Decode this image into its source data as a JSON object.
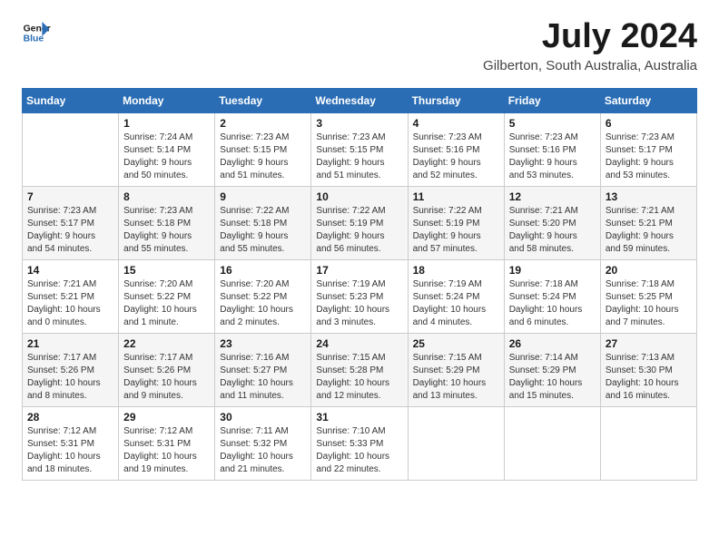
{
  "header": {
    "logo_line1": "General",
    "logo_line2": "Blue",
    "month": "July 2024",
    "location": "Gilberton, South Australia, Australia"
  },
  "weekdays": [
    "Sunday",
    "Monday",
    "Tuesday",
    "Wednesday",
    "Thursday",
    "Friday",
    "Saturday"
  ],
  "weeks": [
    [
      {
        "day": "",
        "info": ""
      },
      {
        "day": "1",
        "info": "Sunrise: 7:24 AM\nSunset: 5:14 PM\nDaylight: 9 hours\nand 50 minutes."
      },
      {
        "day": "2",
        "info": "Sunrise: 7:23 AM\nSunset: 5:15 PM\nDaylight: 9 hours\nand 51 minutes."
      },
      {
        "day": "3",
        "info": "Sunrise: 7:23 AM\nSunset: 5:15 PM\nDaylight: 9 hours\nand 51 minutes."
      },
      {
        "day": "4",
        "info": "Sunrise: 7:23 AM\nSunset: 5:16 PM\nDaylight: 9 hours\nand 52 minutes."
      },
      {
        "day": "5",
        "info": "Sunrise: 7:23 AM\nSunset: 5:16 PM\nDaylight: 9 hours\nand 53 minutes."
      },
      {
        "day": "6",
        "info": "Sunrise: 7:23 AM\nSunset: 5:17 PM\nDaylight: 9 hours\nand 53 minutes."
      }
    ],
    [
      {
        "day": "7",
        "info": "Sunrise: 7:23 AM\nSunset: 5:17 PM\nDaylight: 9 hours\nand 54 minutes."
      },
      {
        "day": "8",
        "info": "Sunrise: 7:23 AM\nSunset: 5:18 PM\nDaylight: 9 hours\nand 55 minutes."
      },
      {
        "day": "9",
        "info": "Sunrise: 7:22 AM\nSunset: 5:18 PM\nDaylight: 9 hours\nand 55 minutes."
      },
      {
        "day": "10",
        "info": "Sunrise: 7:22 AM\nSunset: 5:19 PM\nDaylight: 9 hours\nand 56 minutes."
      },
      {
        "day": "11",
        "info": "Sunrise: 7:22 AM\nSunset: 5:19 PM\nDaylight: 9 hours\nand 57 minutes."
      },
      {
        "day": "12",
        "info": "Sunrise: 7:21 AM\nSunset: 5:20 PM\nDaylight: 9 hours\nand 58 minutes."
      },
      {
        "day": "13",
        "info": "Sunrise: 7:21 AM\nSunset: 5:21 PM\nDaylight: 9 hours\nand 59 minutes."
      }
    ],
    [
      {
        "day": "14",
        "info": "Sunrise: 7:21 AM\nSunset: 5:21 PM\nDaylight: 10 hours\nand 0 minutes."
      },
      {
        "day": "15",
        "info": "Sunrise: 7:20 AM\nSunset: 5:22 PM\nDaylight: 10 hours\nand 1 minute."
      },
      {
        "day": "16",
        "info": "Sunrise: 7:20 AM\nSunset: 5:22 PM\nDaylight: 10 hours\nand 2 minutes."
      },
      {
        "day": "17",
        "info": "Sunrise: 7:19 AM\nSunset: 5:23 PM\nDaylight: 10 hours\nand 3 minutes."
      },
      {
        "day": "18",
        "info": "Sunrise: 7:19 AM\nSunset: 5:24 PM\nDaylight: 10 hours\nand 4 minutes."
      },
      {
        "day": "19",
        "info": "Sunrise: 7:18 AM\nSunset: 5:24 PM\nDaylight: 10 hours\nand 6 minutes."
      },
      {
        "day": "20",
        "info": "Sunrise: 7:18 AM\nSunset: 5:25 PM\nDaylight: 10 hours\nand 7 minutes."
      }
    ],
    [
      {
        "day": "21",
        "info": "Sunrise: 7:17 AM\nSunset: 5:26 PM\nDaylight: 10 hours\nand 8 minutes."
      },
      {
        "day": "22",
        "info": "Sunrise: 7:17 AM\nSunset: 5:26 PM\nDaylight: 10 hours\nand 9 minutes."
      },
      {
        "day": "23",
        "info": "Sunrise: 7:16 AM\nSunset: 5:27 PM\nDaylight: 10 hours\nand 11 minutes."
      },
      {
        "day": "24",
        "info": "Sunrise: 7:15 AM\nSunset: 5:28 PM\nDaylight: 10 hours\nand 12 minutes."
      },
      {
        "day": "25",
        "info": "Sunrise: 7:15 AM\nSunset: 5:29 PM\nDaylight: 10 hours\nand 13 minutes."
      },
      {
        "day": "26",
        "info": "Sunrise: 7:14 AM\nSunset: 5:29 PM\nDaylight: 10 hours\nand 15 minutes."
      },
      {
        "day": "27",
        "info": "Sunrise: 7:13 AM\nSunset: 5:30 PM\nDaylight: 10 hours\nand 16 minutes."
      }
    ],
    [
      {
        "day": "28",
        "info": "Sunrise: 7:12 AM\nSunset: 5:31 PM\nDaylight: 10 hours\nand 18 minutes."
      },
      {
        "day": "29",
        "info": "Sunrise: 7:12 AM\nSunset: 5:31 PM\nDaylight: 10 hours\nand 19 minutes."
      },
      {
        "day": "30",
        "info": "Sunrise: 7:11 AM\nSunset: 5:32 PM\nDaylight: 10 hours\nand 21 minutes."
      },
      {
        "day": "31",
        "info": "Sunrise: 7:10 AM\nSunset: 5:33 PM\nDaylight: 10 hours\nand 22 minutes."
      },
      {
        "day": "",
        "info": ""
      },
      {
        "day": "",
        "info": ""
      },
      {
        "day": "",
        "info": ""
      }
    ]
  ]
}
